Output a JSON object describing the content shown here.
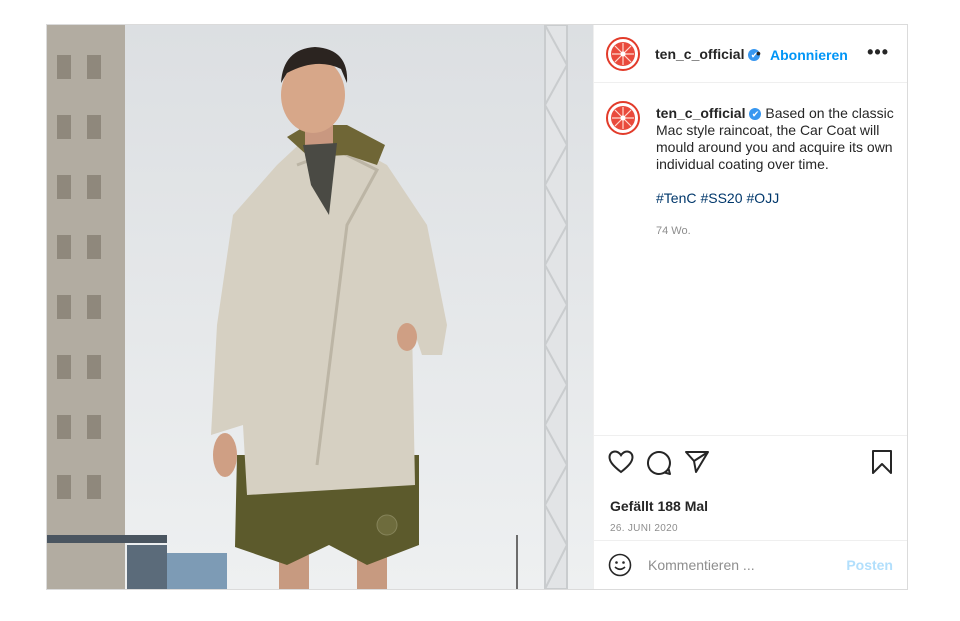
{
  "post": {
    "username": "ten_c_official",
    "verified_glyph": "✔",
    "separator": "•",
    "follow_label": "Abonnieren",
    "more_label": "•••",
    "caption_text": " Based on the classic Mac style raincoat, the Car Coat will mould around you and acquire its own individual coating over time.",
    "hashtags": [
      "#TenC",
      "#SS20",
      "#OJJ"
    ],
    "time_ago": "74 Wo.",
    "likes": "Gefällt 188 Mal",
    "date": "26. JUNI 2020",
    "comment_placeholder": "Kommentieren ...",
    "post_label": "Posten"
  },
  "icons": {
    "like": "heart-icon",
    "comment": "speech-bubble-icon",
    "share": "paper-plane-icon",
    "save": "bookmark-icon",
    "emoji": "smiley-icon"
  },
  "colors": {
    "follow": "#0095f6",
    "hashtag": "#00376b",
    "avatar_ring": "#e23b2a",
    "post_disabled": "#b2dffc"
  }
}
